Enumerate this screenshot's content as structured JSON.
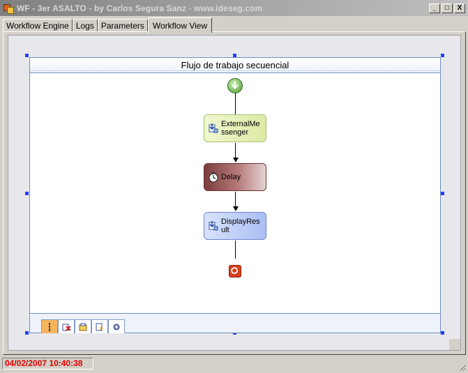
{
  "window": {
    "title": "WF - 3er ASALTO - by Carlos Segura Sanz - www.ideseg.com",
    "minimize_label": "_",
    "maximize_label": "□",
    "close_label": "X"
  },
  "tabs": [
    {
      "label": "Workflow Engine"
    },
    {
      "label": "Logs"
    },
    {
      "label": "Parameters"
    },
    {
      "label": "Workflow View",
      "active": true
    }
  ],
  "workflow": {
    "title": "Flujo de trabajo secuencial",
    "activities": [
      {
        "label_line1": "ExternalMe",
        "label_line2": "ssenger",
        "icon": "external-event-icon",
        "color": "#dbe9a4"
      },
      {
        "label_line1": "Delay",
        "label_line2": "",
        "icon": "stopwatch-icon",
        "color": "#7b3d3d"
      },
      {
        "label_line1": "DisplayRes",
        "label_line2": "ult",
        "icon": "code-activity-icon",
        "color": "#a9bff3"
      }
    ],
    "view_tabs": [
      {
        "icon": "workflow-view-icon"
      },
      {
        "icon": "cancel-handler-icon"
      },
      {
        "icon": "fault-handlers-icon"
      },
      {
        "icon": "event-handlers-icon"
      },
      {
        "icon": "compensation-icon"
      }
    ]
  },
  "status": {
    "datetime": "04/02/2007 10:40:38",
    "color": "#e00000"
  }
}
